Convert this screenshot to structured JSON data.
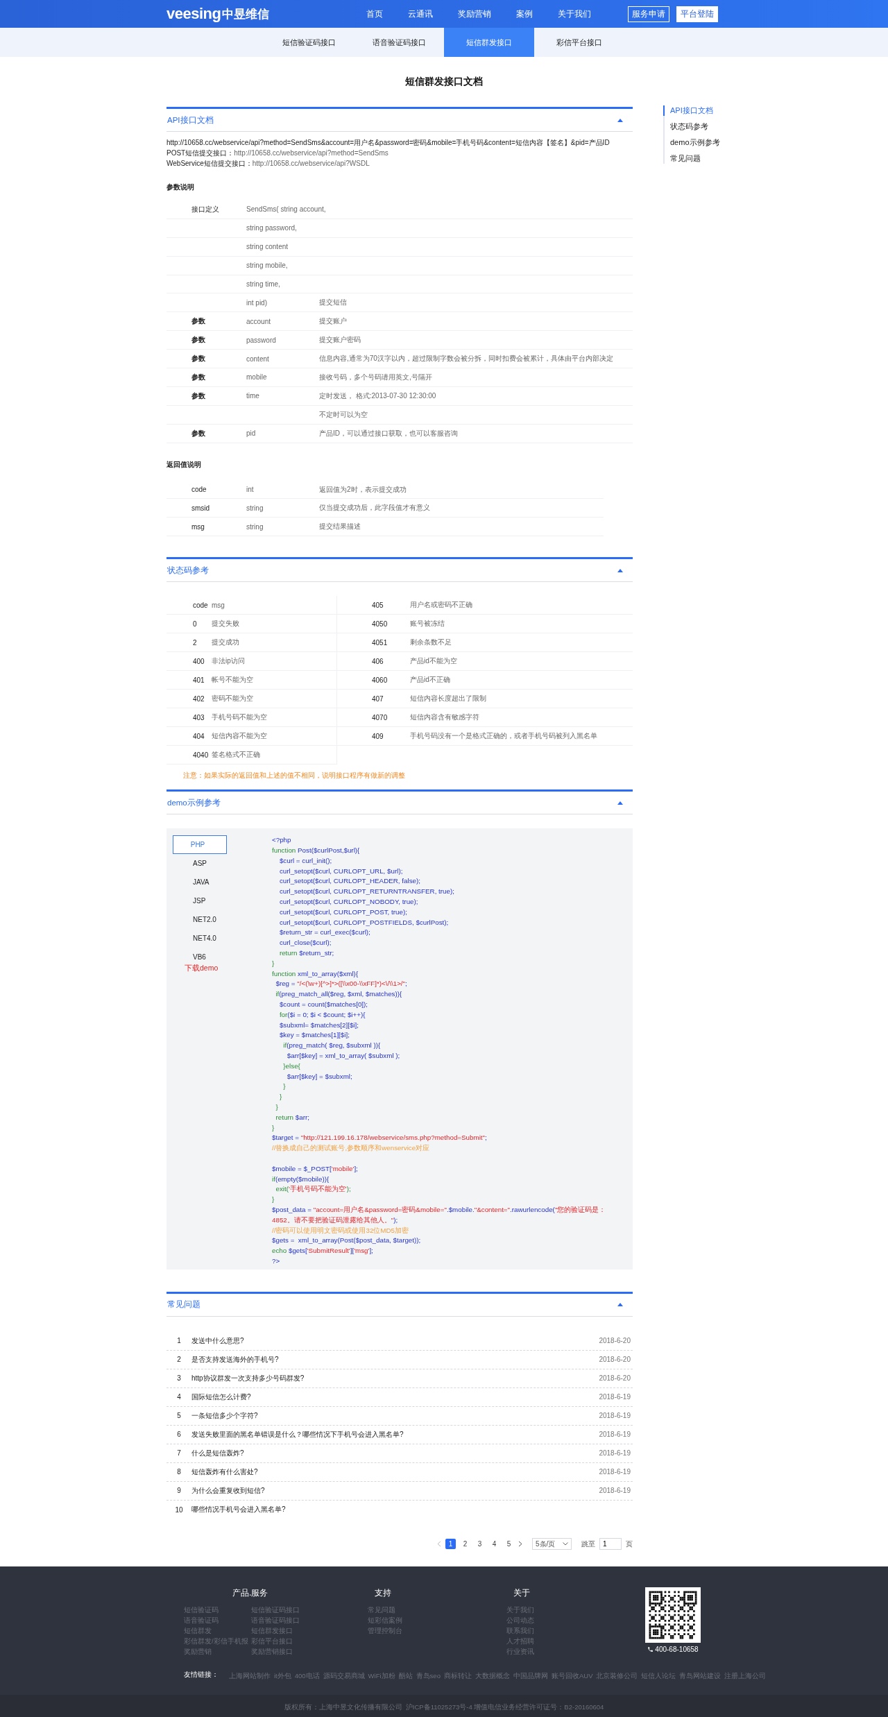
{
  "header": {
    "logo_word": "veesing",
    "logo_cn": "中昱维信",
    "nav": [
      "首页",
      "云通讯",
      "奖励营销",
      "案例",
      "关于我们"
    ],
    "apply_button": "服务申请",
    "login_button": "平台登陆"
  },
  "subnav": [
    {
      "label": "短信验证码接口",
      "selected": false
    },
    {
      "label": "语音验证码接口",
      "selected": false
    },
    {
      "label": "短信群发接口",
      "selected": true
    },
    {
      "label": "彩信平台接口",
      "selected": false
    }
  ],
  "page_title": "短信群发接口文档",
  "side_nav": [
    {
      "label": "API接口文档",
      "selected": true
    },
    {
      "label": "状态码参考",
      "selected": false
    },
    {
      "label": "demo示例参考",
      "selected": false
    },
    {
      "label": "常见问题",
      "selected": false
    }
  ],
  "api_section": {
    "title": "API接口文档",
    "expanded": true,
    "url_line": "http://10658.cc/webservice/api?method=SendSms&account=用户名&password=密码&mobile=手机号码&content=短信内容【签名】&pid=产品ID",
    "endpoints": [
      {
        "label": "POST短信提交接口：",
        "url": "http://10658.cc/webservice/api?method=SendSms"
      },
      {
        "label": "WebService短信提交接口：",
        "url": "http://10658.cc/webservice/api?WSDL"
      }
    ],
    "params_heading": "参数说明",
    "params": [
      {
        "label": "接口定义",
        "name": "SendSms( string account,"
      },
      {
        "name": "string password,"
      },
      {
        "name": "string content"
      },
      {
        "name": "string mobile,"
      },
      {
        "name": "string time,"
      },
      {
        "name": "int pid)",
        "description": "提交短信"
      },
      {
        "label": "参数",
        "name": "account",
        "description": "提交账户"
      },
      {
        "label": "参数",
        "name": "password",
        "description": "提交账户密码"
      },
      {
        "label": "参数",
        "name": "content",
        "description": "信息内容,通常为70汉字以内，超过限制字数会被分拆，同时扣费会被累计，具体由平台内部决定"
      },
      {
        "label": "参数",
        "name": "mobile",
        "description": "接收号码，多个号码请用英文,号隔开"
      },
      {
        "label": "参数",
        "name": "time",
        "description": "定时发送， 格式:2013-07-30 12:30:00"
      },
      {
        "description": "不定时可以为空"
      },
      {
        "label": "参数",
        "name": "pid",
        "description": "产品ID，可以通过接口获取，也可以客服咨询"
      }
    ],
    "return_heading": "返回值说明",
    "returns": [
      {
        "name": "code",
        "type": "int",
        "description": "返回值为2时，表示提交成功"
      },
      {
        "name": "smsid",
        "type": "string",
        "description": "仅当提交成功后，此字段值才有意义"
      },
      {
        "name": "msg",
        "type": "string",
        "description": "提交结果描述"
      }
    ]
  },
  "status_section": {
    "title": "状态码参考",
    "expanded": true,
    "columns": [
      "code",
      "msg"
    ],
    "left_rows": [
      {
        "code": "0",
        "msg": "提交失败"
      },
      {
        "code": "2",
        "msg": "提交成功"
      },
      {
        "code": "400",
        "msg": "非法ip访问"
      },
      {
        "code": "401",
        "msg": "帐号不能为空"
      },
      {
        "code": "402",
        "msg": "密码不能为空"
      },
      {
        "code": "403",
        "msg": "手机号码不能为空"
      },
      {
        "code": "404",
        "msg": "短信内容不能为空"
      },
      {
        "code": "4040",
        "msg": "签名格式不正确"
      }
    ],
    "right_rows": [
      {
        "code": "405",
        "msg": "用户名或密码不正确"
      },
      {
        "code": "4050",
        "msg": "账号被冻结"
      },
      {
        "code": "4051",
        "msg": "剩余条数不足"
      },
      {
        "code": "406",
        "msg": "产品id不能为空"
      },
      {
        "code": "4060",
        "msg": "产品id不正确"
      },
      {
        "code": "407",
        "msg": "短信内容长度超出了限制"
      },
      {
        "code": "4070",
        "msg": "短信内容含有敏感字符"
      },
      {
        "code": "409",
        "msg": "手机号码没有一个是格式正确的，或者手机号码被列入黑名单"
      }
    ],
    "note": "注意：如果实际的返回值和上述的值不相同，说明接口程序有做新的调整"
  },
  "demo_section": {
    "title": "demo示例参考",
    "expanded": true,
    "languages": [
      {
        "label": "PHP",
        "selected": true
      },
      {
        "label": "ASP",
        "selected": false
      },
      {
        "label": "JAVA",
        "selected": false
      },
      {
        "label": "JSP",
        "selected": false
      },
      {
        "label": "NET2.0",
        "selected": false
      },
      {
        "label": "NET4.0",
        "selected": false
      },
      {
        "label": "VB6",
        "selected": false
      }
    ],
    "download_link": "下载demo",
    "code": [
      {
        "kind": "code",
        "parts": [
          {
            "kind": "var",
            "text": "<?php"
          }
        ]
      },
      {
        "kind": "code",
        "parts": [
          {
            "kind": "kw",
            "text": "function "
          },
          {
            "kind": "var",
            "text": "Post($curlPost,$url){"
          }
        ]
      },
      {
        "kind": "code",
        "parts": [
          {
            "kind": "var",
            "text": "    $curl = curl_init();"
          }
        ]
      },
      {
        "kind": "code",
        "parts": [
          {
            "kind": "var",
            "text": "    curl_setopt($curl, CURLOPT_URL, $url);"
          }
        ]
      },
      {
        "kind": "code",
        "parts": [
          {
            "kind": "var",
            "text": "    curl_setopt($curl, CURLOPT_HEADER, false);"
          }
        ]
      },
      {
        "kind": "code",
        "parts": [
          {
            "kind": "var",
            "text": "    curl_setopt($curl, CURLOPT_RETURNTRANSFER, true);"
          }
        ]
      },
      {
        "kind": "code",
        "parts": [
          {
            "kind": "var",
            "text": "    curl_setopt($curl, CURLOPT_NOBODY, true);"
          }
        ]
      },
      {
        "kind": "code",
        "parts": [
          {
            "kind": "var",
            "text": "    curl_setopt($curl, CURLOPT_POST, true);"
          }
        ]
      },
      {
        "kind": "code",
        "parts": [
          {
            "kind": "var",
            "text": "    curl_setopt($curl, CURLOPT_POSTFIELDS, $curlPost);"
          }
        ]
      },
      {
        "kind": "code",
        "parts": [
          {
            "kind": "var",
            "text": "    $return_str = curl_exec($curl);"
          }
        ]
      },
      {
        "kind": "code",
        "parts": [
          {
            "kind": "var",
            "text": "    curl_close($curl);"
          }
        ]
      },
      {
        "kind": "code",
        "parts": [
          {
            "kind": "kw",
            "text": "    return "
          },
          {
            "kind": "var",
            "text": "$return_str;"
          }
        ]
      },
      {
        "kind": "code",
        "parts": [
          {
            "kind": "kw",
            "text": "}"
          }
        ]
      },
      {
        "kind": "code",
        "parts": [
          {
            "kind": "kw",
            "text": "function "
          },
          {
            "kind": "var",
            "text": "xml_to_array($xml){"
          }
        ]
      },
      {
        "kind": "code",
        "parts": [
          {
            "kind": "var",
            "text": "  $reg = "
          },
          {
            "kind": "str",
            "text": "\"/<(\\w+)[^>]*>([\\\\x00-\\\\xFF]*)<\\/\\\\1>/\""
          },
          {
            "kind": "var",
            "text": ";"
          }
        ]
      },
      {
        "kind": "code",
        "parts": [
          {
            "kind": "kw",
            "text": "  if"
          },
          {
            "kind": "var",
            "text": "(preg_match_all($reg, $xml, $matches)){"
          }
        ]
      },
      {
        "kind": "code",
        "parts": [
          {
            "kind": "var",
            "text": "    $count = count($matches[0]);"
          }
        ]
      },
      {
        "kind": "code",
        "parts": [
          {
            "kind": "kw",
            "text": "    for"
          },
          {
            "kind": "var",
            "text": "($i = 0; $i < $count; $i++){"
          }
        ]
      },
      {
        "kind": "code",
        "parts": [
          {
            "kind": "var",
            "text": "    $subxml= $matches[2][$i];"
          }
        ]
      },
      {
        "kind": "code",
        "parts": [
          {
            "kind": "var",
            "text": "    $key = $matches[1][$i];"
          }
        ]
      },
      {
        "kind": "code",
        "parts": [
          {
            "kind": "kw",
            "text": "      if"
          },
          {
            "kind": "var",
            "text": "(preg_match( $reg, $subxml )){"
          }
        ]
      },
      {
        "kind": "code",
        "parts": [
          {
            "kind": "var",
            "text": "        $arr[$key] = xml_to_array( $subxml );"
          }
        ]
      },
      {
        "kind": "code",
        "parts": [
          {
            "kind": "kw",
            "text": "      }else{"
          }
        ]
      },
      {
        "kind": "code",
        "parts": [
          {
            "kind": "var",
            "text": "        $arr[$key] = $subxml;"
          }
        ]
      },
      {
        "kind": "code",
        "parts": [
          {
            "kind": "kw",
            "text": "      }"
          }
        ]
      },
      {
        "kind": "code",
        "parts": [
          {
            "kind": "kw",
            "text": "    }"
          }
        ]
      },
      {
        "kind": "code",
        "parts": [
          {
            "kind": "kw",
            "text": "  }"
          }
        ]
      },
      {
        "kind": "code",
        "parts": [
          {
            "kind": "kw",
            "text": "  return "
          },
          {
            "kind": "var",
            "text": "$arr;"
          }
        ]
      },
      {
        "kind": "code",
        "parts": [
          {
            "kind": "kw",
            "text": "}"
          }
        ]
      },
      {
        "kind": "code",
        "parts": [
          {
            "kind": "var",
            "text": "$target = "
          },
          {
            "kind": "str",
            "text": "\"http://121.199.16.178/webservice/sms.php?method=Submit\""
          },
          {
            "kind": "var",
            "text": ";"
          }
        ]
      },
      {
        "kind": "code",
        "parts": [
          {
            "kind": "comment",
            "text": "//替换成自己的测试账号,参数顺序和wenservice对应"
          }
        ]
      },
      {
        "kind": "blank"
      },
      {
        "kind": "code",
        "parts": [
          {
            "kind": "var",
            "text": "$mobile = $_POST["
          },
          {
            "kind": "str",
            "text": "'mobile'"
          },
          {
            "kind": "var",
            "text": "];"
          }
        ]
      },
      {
        "kind": "code",
        "parts": [
          {
            "kind": "kw",
            "text": "if"
          },
          {
            "kind": "var",
            "text": "(empty($mobile)){"
          }
        ]
      },
      {
        "kind": "code",
        "parts": [
          {
            "kind": "kw",
            "text": "  exit("
          },
          {
            "kind": "str",
            "text": "'手机号码不能为空'"
          },
          {
            "kind": "kw",
            "text": ");"
          }
        ]
      },
      {
        "kind": "code",
        "parts": [
          {
            "kind": "kw",
            "text": "}"
          }
        ]
      },
      {
        "kind": "code",
        "parts": [
          {
            "kind": "var",
            "text": "$post_data = "
          },
          {
            "kind": "str",
            "text": "\"account=用户名&password=密码&mobile=\""
          },
          {
            "kind": "var",
            "text": ".$mobile."
          },
          {
            "kind": "str",
            "text": "\"&content=\""
          },
          {
            "kind": "var",
            "text": ".rawurlencode("
          },
          {
            "kind": "str",
            "text": "\"您的验证码是："
          }
        ]
      },
      {
        "kind": "code",
        "parts": [
          {
            "kind": "str",
            "text": "4852。请不要把验证码泄露给其他人。\""
          },
          {
            "kind": "var",
            "text": ");"
          }
        ]
      },
      {
        "kind": "code",
        "parts": [
          {
            "kind": "comment",
            "text": "//密码可以使用明文密码或使用32位MD5加密"
          }
        ]
      },
      {
        "kind": "code",
        "parts": [
          {
            "kind": "var",
            "text": "$gets =  xml_to_array(Post($post_data, $target));"
          }
        ]
      },
      {
        "kind": "code",
        "parts": [
          {
            "kind": "kw",
            "text": "echo "
          },
          {
            "kind": "var",
            "text": "$gets["
          },
          {
            "kind": "str",
            "text": "'SubmitResult'"
          },
          {
            "kind": "var",
            "text": "]["
          },
          {
            "kind": "str",
            "text": "'msg'"
          },
          {
            "kind": "var",
            "text": "];"
          }
        ]
      },
      {
        "kind": "code",
        "parts": [
          {
            "kind": "var",
            "text": "?>"
          }
        ]
      }
    ]
  },
  "faq_section": {
    "title": "常见问题",
    "expanded": true,
    "items": [
      {
        "number": "1",
        "question": "发送中什么意思?",
        "date": "2018-6-20"
      },
      {
        "number": "2",
        "question": "是否支持发送海外的手机号?",
        "date": "2018-6-20"
      },
      {
        "number": "3",
        "question": "http协议群发一次支持多少号码群发?",
        "date": "2018-6-20"
      },
      {
        "number": "4",
        "question": "国际短信怎么计费?",
        "date": "2018-6-19"
      },
      {
        "number": "5",
        "question": "一条短信多少个字符?",
        "date": "2018-6-19"
      },
      {
        "number": "6",
        "question": "发送失败里面的黑名单错误是什么？哪些情况下手机号会进入黑名单?",
        "date": "2018-6-19"
      },
      {
        "number": "7",
        "question": "什么是短信轰炸?",
        "date": "2018-6-19"
      },
      {
        "number": "8",
        "question": "短信轰炸有什么害处?",
        "date": "2018-6-19"
      },
      {
        "number": "9",
        "question": "为什么会重复收到短信?",
        "date": "2018-6-19"
      },
      {
        "number": "10",
        "question": "哪些情况手机号会进入黑名单?"
      }
    ],
    "pagination": {
      "pages": [
        {
          "label": "1",
          "selected": true
        },
        {
          "label": "2",
          "selected": false
        },
        {
          "label": "3",
          "selected": false
        },
        {
          "label": "4",
          "selected": false
        },
        {
          "label": "5",
          "selected": false
        }
      ],
      "page_size": "5条/页",
      "jump_label": "跳至",
      "jump_value": "1",
      "page_unit": "页"
    }
  },
  "footer": {
    "columns": [
      {
        "title": "产品.服务",
        "groups": [
          [
            "短信验证码",
            "语音验证码",
            "短信群发",
            "彩信群发/彩信手机报",
            "奖励营销"
          ],
          [
            "短信验证码接口",
            "语音验证码接口",
            "短信群发接口",
            "彩信平台接口",
            "奖励营销接口"
          ]
        ]
      },
      {
        "title": "支持",
        "groups": [
          [
            "常见问题",
            "短彩信案例",
            "管理控制台"
          ]
        ]
      },
      {
        "title": "关于",
        "groups": [
          [
            "关于我们",
            "公司动态",
            "联系我们",
            "人才招聘",
            "行业资讯"
          ]
        ]
      }
    ],
    "phone": "400-68-10658",
    "links_label": "友情链接：",
    "links": [
      "上海网站制作",
      "it外包",
      "400电话",
      "源码交易商城",
      "WiFi加粉",
      "酷站",
      "青岛seo",
      "商标转让",
      "大数据概念",
      "中国品牌网",
      "账号回收AUV",
      "北京装修公司",
      "短信人论坛",
      "青岛网站建设",
      "注册上海公司"
    ],
    "copyright": "版权所有：上海中昱文化传播有限公司  沪ICP备11025273号-4 增值电信业务经营许可证号：B2-20160604"
  }
}
